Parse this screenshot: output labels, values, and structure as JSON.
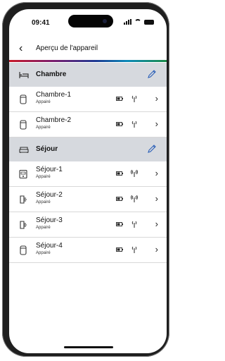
{
  "status": {
    "time": "09:41"
  },
  "nav": {
    "title": "Aperçu de l'appareil",
    "back_glyph": "‹"
  },
  "colors": {
    "accent_gradient": [
      "#c81b2a",
      "#7a1f6f",
      "#1f3b93",
      "#0c8ab8",
      "#1d8c4a"
    ],
    "section_bg": "#d6d9de",
    "edit_blue": "#2a5fb8"
  },
  "sections": [
    {
      "title": "Chambre",
      "icon": "bed-icon",
      "devices": [
        {
          "name": "Chambre-1",
          "status": "Appairé",
          "icon": "thermostat-icon"
        },
        {
          "name": "Chambre-2",
          "status": "Appairé",
          "icon": "thermostat-icon"
        }
      ]
    },
    {
      "title": "Séjour",
      "icon": "sofa-icon",
      "devices": [
        {
          "name": "Séjour-1",
          "status": "Appairé",
          "icon": "room-thermostat-icon"
        },
        {
          "name": "Séjour-2",
          "status": "Appairé",
          "icon": "radiator-valve-icon"
        },
        {
          "name": "Séjour-3",
          "status": "Appairé",
          "icon": "radiator-valve-icon"
        },
        {
          "name": "Séjour-4",
          "status": "Appairé",
          "icon": "thermostat-icon"
        }
      ]
    }
  ],
  "chevron": "›"
}
